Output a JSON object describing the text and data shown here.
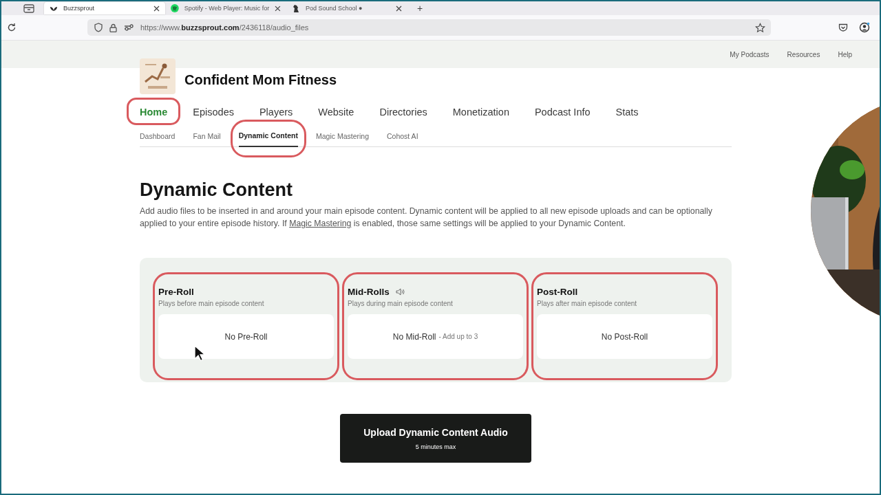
{
  "browser": {
    "tabs": [
      {
        "title": "Buzzsprout",
        "selected": true
      },
      {
        "title": "Spotify - Web Player: Music for",
        "selected": false
      },
      {
        "title": "Pod Sound School ●",
        "selected": false
      }
    ],
    "new_tab": "+",
    "url": "https://www.**buzzsprout.com**/2436118/audio_files"
  },
  "site": {
    "top_links": [
      "My Podcasts",
      "Resources",
      "Help"
    ],
    "podcast_title": "Confident Mom Fitness",
    "nav": [
      {
        "label": "Home",
        "selected": true,
        "highlighted": true
      },
      {
        "label": "Episodes",
        "selected": false,
        "highlighted": false
      },
      {
        "label": "Players",
        "selected": false,
        "highlighted": false
      },
      {
        "label": "Website",
        "selected": false,
        "highlighted": false
      },
      {
        "label": "Directories",
        "selected": false,
        "highlighted": false
      },
      {
        "label": "Monetization",
        "selected": false,
        "highlighted": false
      },
      {
        "label": "Podcast Info",
        "selected": false,
        "highlighted": false
      },
      {
        "label": "Stats",
        "selected": false,
        "highlighted": false
      }
    ],
    "subnav": [
      {
        "label": "Dashboard",
        "selected": false,
        "highlighted": false
      },
      {
        "label": "Fan Mail",
        "selected": false,
        "highlighted": false
      },
      {
        "label": "Dynamic Content",
        "selected": true,
        "highlighted": true
      },
      {
        "label": "Magic Mastering",
        "selected": false,
        "highlighted": false
      },
      {
        "label": "Cohost AI",
        "selected": false,
        "highlighted": false
      }
    ]
  },
  "page": {
    "heading": "Dynamic Content",
    "description_before": "Add audio files to be inserted in and around your main episode content. Dynamic content will be applied to all new episode uploads and can be optionally applied to your entire episode history. If ",
    "description_link": "Magic Mastering",
    "description_after": " is enabled, those same settings will be applied to your Dynamic Content.",
    "slots": [
      {
        "kind": "plain",
        "title": "Pre-Roll",
        "subtitle": "Plays before main episode content",
        "empty_text": "No Pre-Roll",
        "highlighted": true
      },
      {
        "kind": "with-icon",
        "title": "Mid-Rolls",
        "subtitle": "Plays during main episode content",
        "empty_text": "No Mid-Roll",
        "hint": "- Add up to 3",
        "highlighted": true
      },
      {
        "kind": "plain",
        "title": "Post-Roll",
        "subtitle": "Plays after main episode content",
        "empty_text": "No Post-Roll",
        "highlighted": true
      }
    ],
    "upload_button": {
      "label": "Upload Dynamic Content Audio",
      "note": "5 minutes max"
    }
  }
}
